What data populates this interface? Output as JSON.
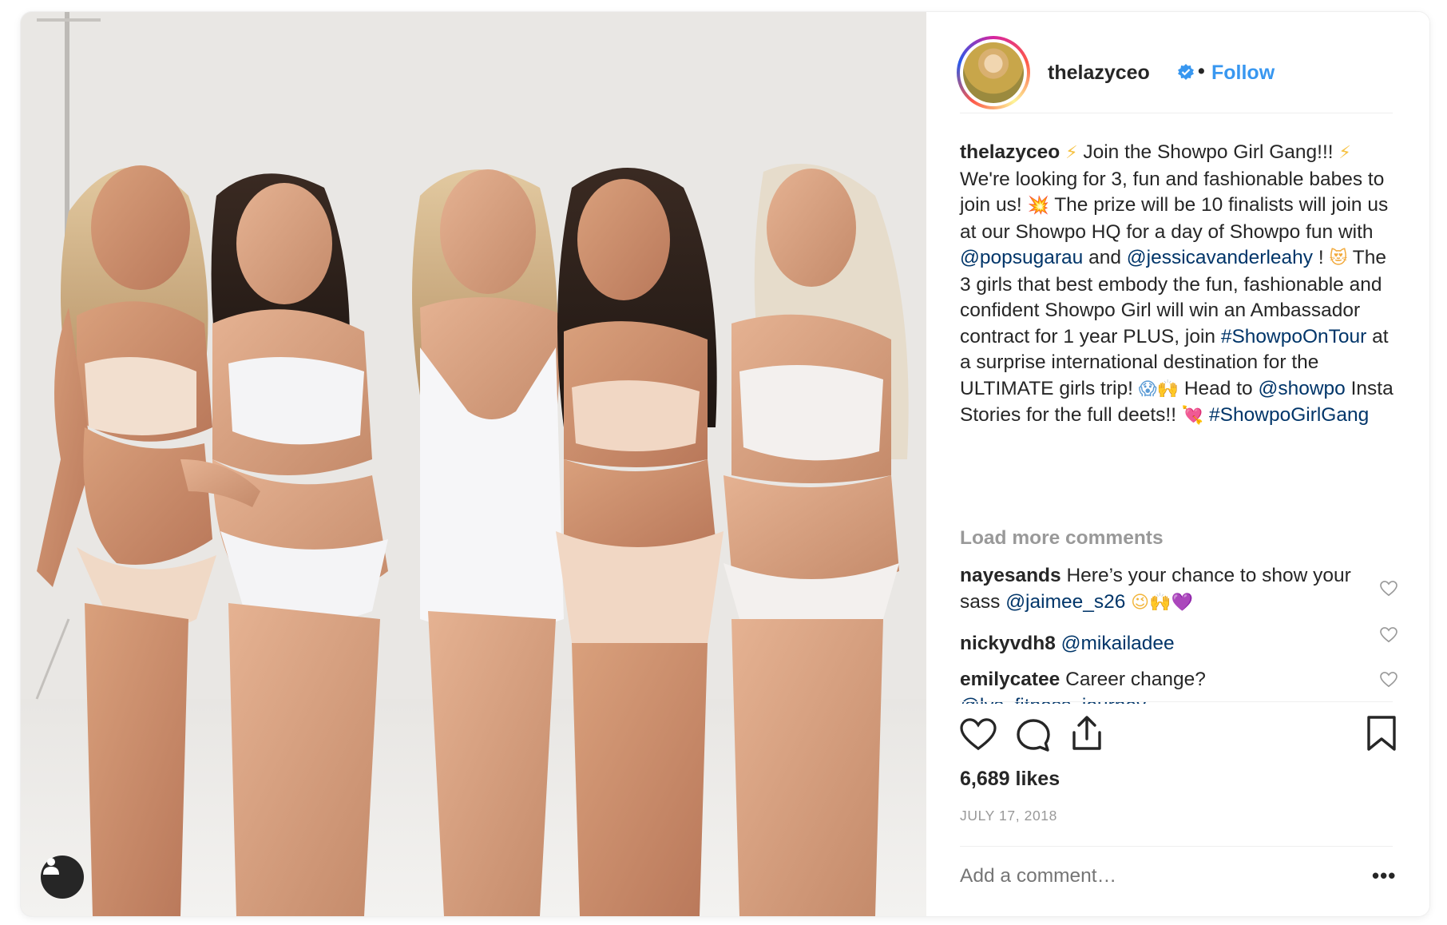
{
  "post": {
    "username": "thelazyceo",
    "follow_label": "Follow",
    "separator": "•",
    "caption": {
      "username": "thelazyceo",
      "t1": " Join the Showpo Girl Gang!!! ",
      "t2": " We're looking for 3, fun and fashionable babes to join us! ",
      "t3": " The prize will be 10 finalists will join us at our Showpo HQ for a day of Showpo fun with ",
      "mention1": "@popsugarau",
      "t4": " and ",
      "mention2": "@jessicavanderleahy",
      "t5": " ! ",
      "t6": " The 3 girls that best embody the fun, fashionable and confident Showpo Girl will win an Ambassador contract for 1 year PLUS, join ",
      "hashtag1": "#ShowpoOnTour",
      "t7": " at a surprise international destination for the ULTIMATE girls trip! ",
      "t8": " Head to ",
      "mention3": "@showpo",
      "t9": " Insta Stories for the full deets!! ",
      "hashtag2": "#ShowpoGirlGang"
    },
    "emoji": {
      "bolt": "⚡",
      "boom": "💥",
      "heart_eyes_cat": "😻",
      "scream": "😱",
      "raised_hands": "🙌",
      "cupid": "💘",
      "wink": "😉",
      "purple_heart": "💜"
    },
    "load_more": "Load more comments",
    "comments": [
      {
        "user": "nayesands",
        "text": " Here’s your chance to show your sass ",
        "mention": "@jaimee_s26"
      },
      {
        "user": "nickyvdh8",
        "text": " ",
        "mention": "@mikailadee"
      },
      {
        "user": "emilycatee",
        "text": " Career change? ",
        "mention": "@lys_fitness_journey"
      }
    ],
    "likes": "6,689 likes",
    "date": "JULY 17, 2018",
    "add_comment_placeholder": "Add a comment…",
    "more_options": "•••",
    "colors": {
      "link": "#003569",
      "follow": "#3897f0",
      "muted": "#999999",
      "text": "#262626",
      "verified": "#3897f0"
    },
    "icons": [
      "heart-icon",
      "comment-icon",
      "share-icon",
      "bookmark-icon",
      "verified-icon",
      "user-tag-icon"
    ]
  }
}
